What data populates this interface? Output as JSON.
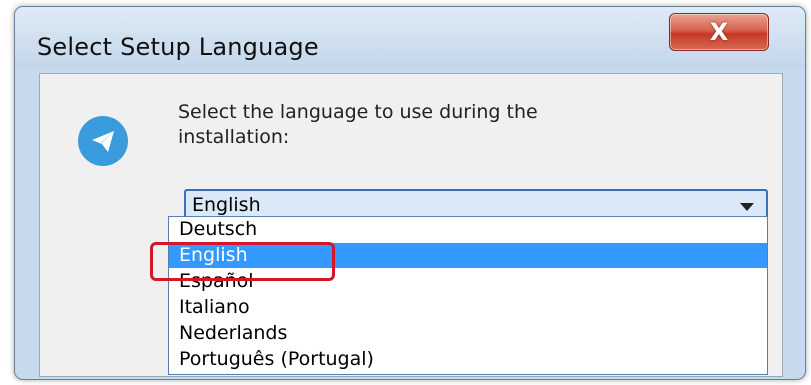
{
  "window": {
    "title": "Select Setup Language",
    "close_label": "X"
  },
  "dialog": {
    "icon": "telegram-paper-plane-icon",
    "prompt": "Select the language to use during the\ninstallation:"
  },
  "language_select": {
    "selected": "English",
    "options": [
      {
        "label": "Deutsch",
        "selected": false
      },
      {
        "label": "English",
        "selected": true
      },
      {
        "label": "Español",
        "selected": false
      },
      {
        "label": "Italiano",
        "selected": false
      },
      {
        "label": "Nederlands",
        "selected": false
      },
      {
        "label": "Português (Portugal)",
        "selected": false
      }
    ]
  },
  "colors": {
    "selection": "#3399ff",
    "annotation": "#d4182a",
    "icon_blue": "#3a9bdc"
  }
}
